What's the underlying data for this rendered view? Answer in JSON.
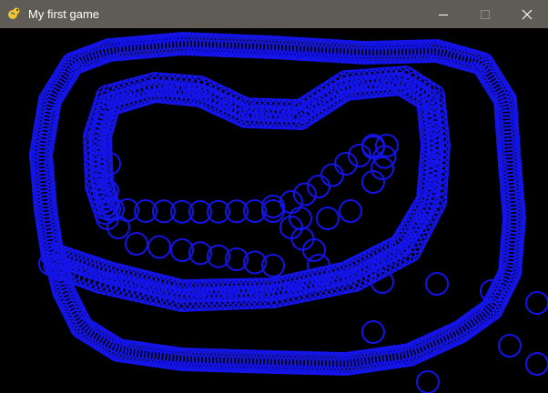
{
  "window": {
    "title": "My first game",
    "app_icon": "pygame-snake-icon",
    "controls": [
      "minimize-icon",
      "maximize-icon",
      "close-icon"
    ]
  },
  "canvas": {
    "background": "#000000",
    "circle_color": "#1414e6",
    "shape": "circle-outline"
  }
}
